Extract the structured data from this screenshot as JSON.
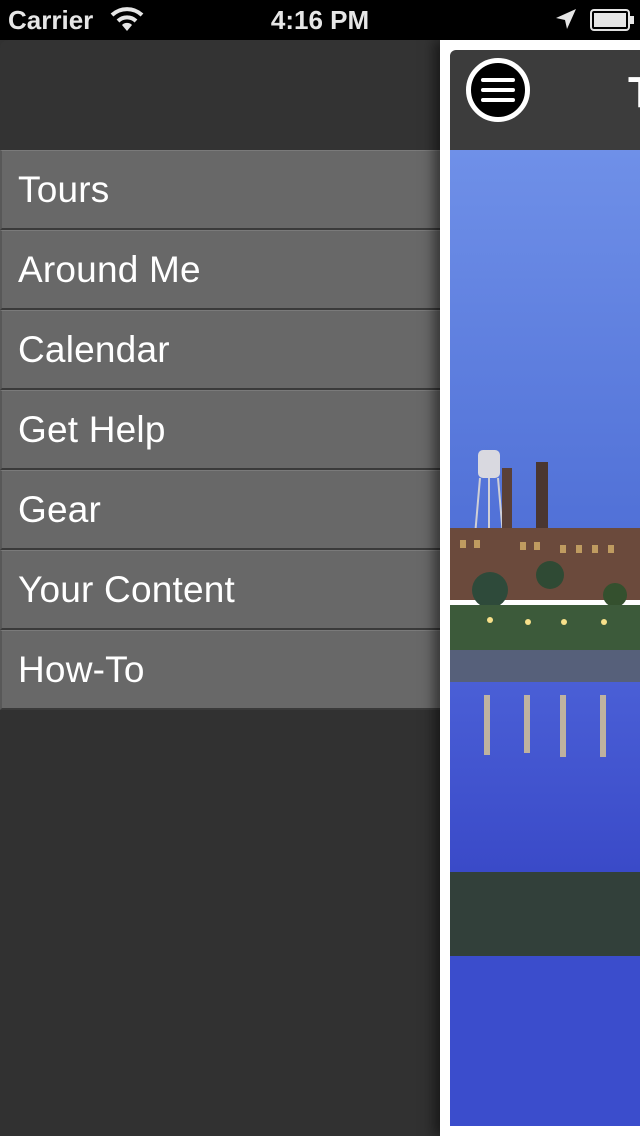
{
  "status_bar": {
    "carrier": "Carrier",
    "time": "4:16 PM",
    "icons": [
      "wifi-icon",
      "location-arrow-icon",
      "battery-icon"
    ]
  },
  "menu": {
    "items": [
      {
        "label": "Tours"
      },
      {
        "label": "Around Me"
      },
      {
        "label": "Calendar"
      },
      {
        "label": "Get Help"
      },
      {
        "label": "Gear"
      },
      {
        "label": "Your Content"
      },
      {
        "label": "How-To"
      }
    ]
  },
  "main": {
    "nav": {
      "menu_icon": "hamburger-menu-icon",
      "title": "T"
    },
    "hero_image": "riverfront-town-at-dusk"
  },
  "colors": {
    "menu_background": "#313131",
    "menu_item": "#686868",
    "nav_bar": "#3c3c3c",
    "sky": "#5c7fe0",
    "water": "#3a4fd0"
  }
}
